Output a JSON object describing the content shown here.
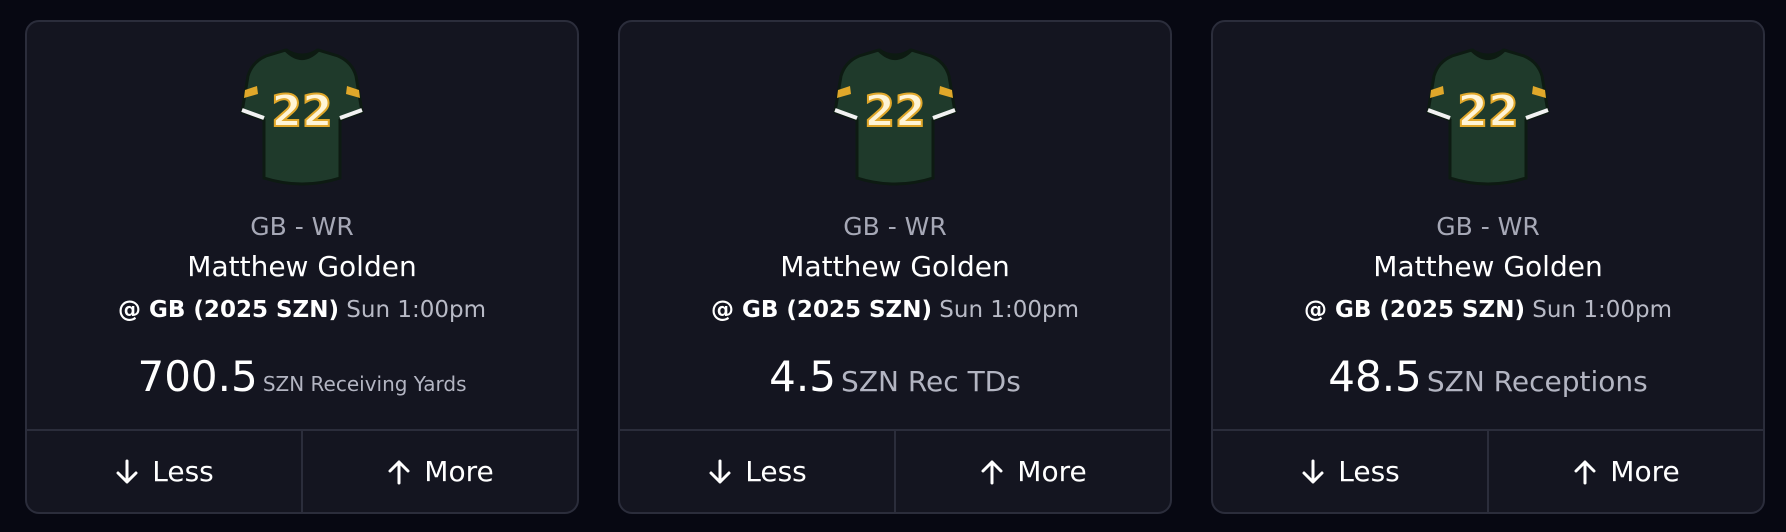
{
  "colors": {
    "background": "#070812",
    "card": "#141520",
    "border": "#2b2d3b",
    "jersey_green": "#203a2c",
    "jersey_gold": "#e0a72a"
  },
  "cards": [
    {
      "icon": "jersey-icon",
      "jersey_number": "22",
      "position": "GB - WR",
      "player_name": "Matthew Golden",
      "matchup_team": "@ GB (2025 SZN)",
      "matchup_time": "Sun 1:00pm",
      "line_value": "700.5",
      "stat_label": "SZN Receiving Yards",
      "less_label": "Less",
      "more_label": "More"
    },
    {
      "icon": "jersey-icon",
      "jersey_number": "22",
      "position": "GB - WR",
      "player_name": "Matthew Golden",
      "matchup_team": "@ GB (2025 SZN)",
      "matchup_time": "Sun 1:00pm",
      "line_value": "4.5",
      "stat_label": "SZN Rec TDs",
      "less_label": "Less",
      "more_label": "More"
    },
    {
      "icon": "jersey-icon",
      "jersey_number": "22",
      "position": "GB - WR",
      "player_name": "Matthew Golden",
      "matchup_team": "@ GB (2025 SZN)",
      "matchup_time": "Sun 1:00pm",
      "line_value": "48.5",
      "stat_label": "SZN Receptions",
      "less_label": "Less",
      "more_label": "More"
    }
  ]
}
